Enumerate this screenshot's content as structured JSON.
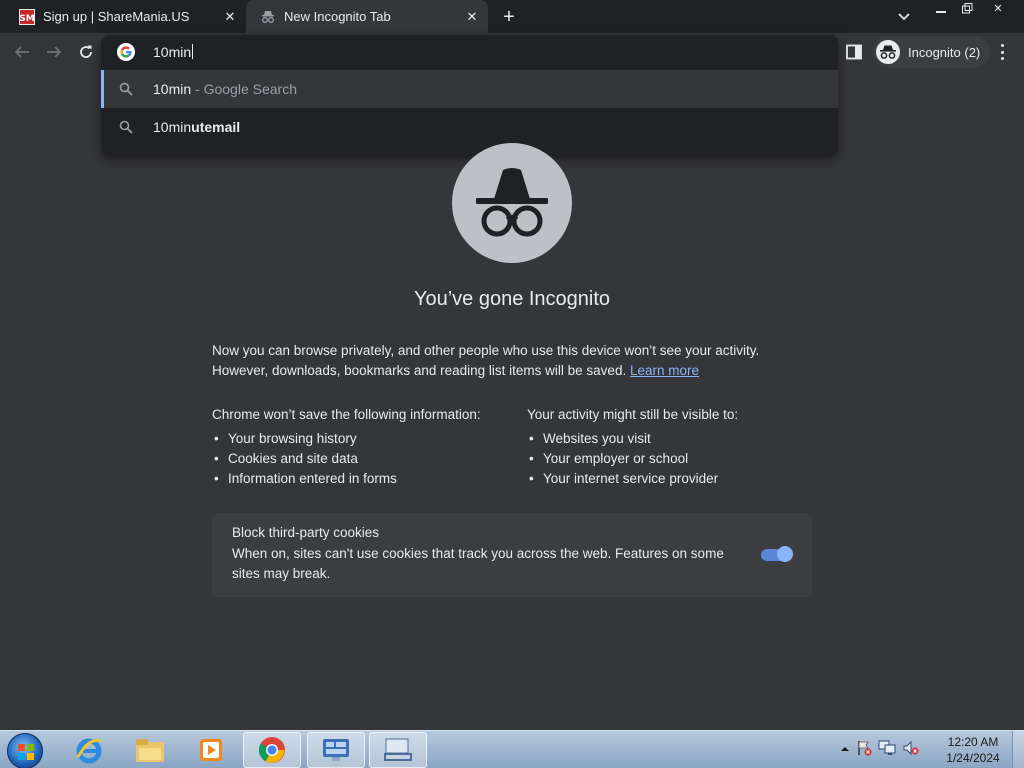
{
  "tabs": [
    {
      "title": "Sign up | ShareMania.US",
      "favicon": "sharemania-logo"
    },
    {
      "title": "New Incognito Tab",
      "favicon": "incognito-icon"
    }
  ],
  "toolbar": {
    "omnibox_text": "10min",
    "profile_label": "Incognito (2)"
  },
  "suggestions": [
    {
      "prefix": "10min",
      "suffix": " - Google Search"
    },
    {
      "prefix": "10min",
      "bold": "utemail"
    }
  ],
  "content": {
    "heading": "You’ve gone Incognito",
    "intro_line1": "Now you can browse privately, and other people who use this device won’t see your activity.",
    "intro_line2": "However, downloads, bookmarks and reading list items will be saved.",
    "learn_more": "Learn more",
    "left_heading_pre": "Chrome ",
    "left_heading_bold": "won’t save",
    "left_heading_post": " the following information:",
    "left_items": [
      "Your browsing history",
      "Cookies and site data",
      "Information entered in forms"
    ],
    "right_heading_pre": "Your activity ",
    "right_heading_bold": "might still be visible",
    "right_heading_post": " to:",
    "right_items": [
      "Websites you visit",
      "Your employer or school",
      "Your internet service provider"
    ],
    "cookie_title": "Block third-party cookies",
    "cookie_desc": "When on, sites can't use cookies that track you across the web. Features on some sites may break.",
    "cookie_toggle_on": true
  },
  "taskbar": {
    "time": "12:20 AM",
    "date": "1/24/2024"
  },
  "colors": {
    "page_bg": "#35363a",
    "tabstrip_bg": "#202124",
    "link": "#8ab4f8",
    "toggle": "#8ab4f8"
  }
}
